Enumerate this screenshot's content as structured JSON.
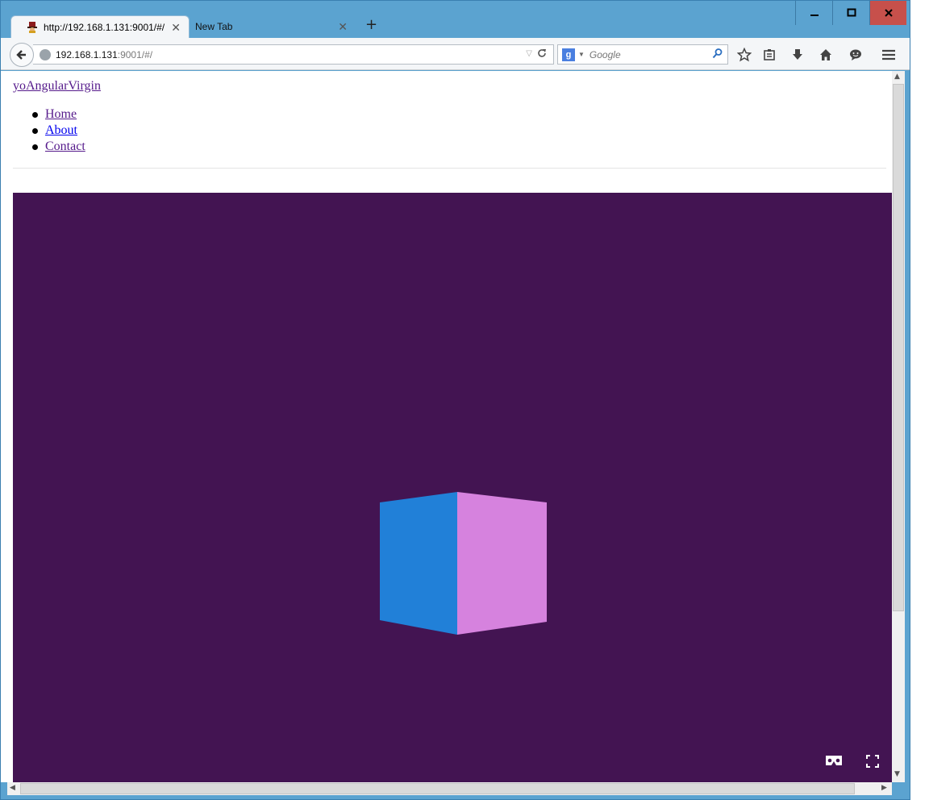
{
  "browser": {
    "tabs": [
      {
        "title": "http://192.168.1.131:9001/#/",
        "active": true
      },
      {
        "title": "New Tab",
        "active": false
      }
    ],
    "new_tab_label": "+",
    "url": {
      "host": "192.168.1.131",
      "rest": ":9001/#/"
    },
    "search": {
      "engine": "g",
      "placeholder": "Google"
    },
    "window_buttons": {
      "minimize": "−",
      "maximize": "□",
      "close": "✕"
    }
  },
  "page": {
    "brand": "yoAngularVirgin",
    "nav": [
      {
        "label": "Home"
      },
      {
        "label": "About"
      },
      {
        "label": "Contact"
      }
    ]
  },
  "scene": {
    "background": "#431452",
    "cube_face_left": "#2180d8",
    "cube_face_right": "#d682de",
    "controls": [
      "vr-cardboard-icon",
      "fullscreen-icon"
    ]
  },
  "icons": {
    "toolbar": [
      "bookmark-star-icon",
      "reading-list-icon",
      "download-icon",
      "home-icon",
      "chat-icon",
      "menu-icon"
    ]
  }
}
